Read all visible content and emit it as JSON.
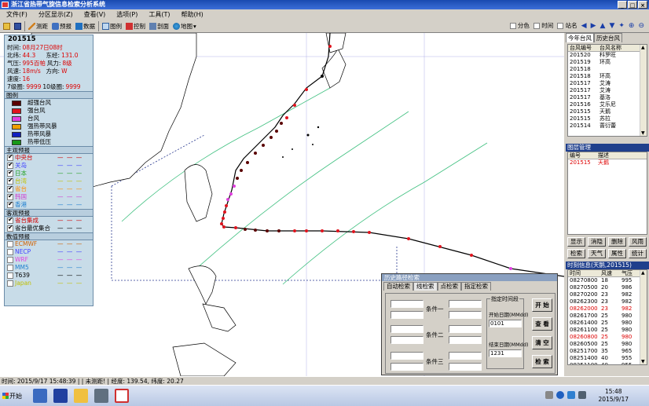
{
  "window": {
    "title": "浙江省热带气旋信息检索分析系统",
    "buttons": [
      "_",
      "□",
      "×"
    ]
  },
  "menu": [
    "文件(F)",
    "分区显示(Z)",
    "查看(V)",
    "选项(P)",
    "工具(T)",
    "帮助(H)"
  ],
  "toolbar": {
    "items": [
      {
        "icon": "folder-open-icon",
        "label": ""
      },
      {
        "icon": "save-icon",
        "label": ""
      },
      {
        "icon": "pencil-icon",
        "label": "测距"
      },
      {
        "icon": "forecast-icon",
        "label": "预报"
      },
      {
        "icon": "data-icon",
        "label": "数据"
      },
      {
        "icon": "layer-icon",
        "label": "图例"
      },
      {
        "icon": "control-icon",
        "label": "控制"
      },
      {
        "icon": "profile-icon",
        "label": "剖面"
      },
      {
        "icon": "globe-icon",
        "label": "地图"
      }
    ],
    "checks": [
      {
        "label": "分色",
        "checked": false
      },
      {
        "label": "时间",
        "checked": false
      },
      {
        "label": "站名",
        "checked": false
      }
    ],
    "nav_arrows": [
      "◀",
      "▶",
      "▲",
      "▼",
      "✦",
      "⊕",
      "⊖"
    ]
  },
  "info": {
    "storm_id": "201515",
    "fields": [
      {
        "label": "时间:",
        "value": "08月27日08时"
      },
      {
        "label": "北纬:",
        "value": "44.3",
        "label2": "东经:",
        "value2": "131.0"
      },
      {
        "label": "气压:",
        "value": "995百帕",
        "label2": "风力:",
        "value2": "8级"
      },
      {
        "label": "风速:",
        "value": "18m/s",
        "label2": "方向:",
        "value2": "W"
      },
      {
        "label": "速度:",
        "value": "16"
      },
      {
        "label": "7级圈:",
        "value": "9999",
        "label2": "10级圈:",
        "value2": "9999"
      }
    ],
    "legend_title": "图例",
    "legend": [
      {
        "label": "超强台风",
        "color": "#5a0000"
      },
      {
        "label": "强台风",
        "color": "#e0141e"
      },
      {
        "label": "台风",
        "color": "#e040e0"
      },
      {
        "label": "强热带风暴",
        "color": "#f0a000"
      },
      {
        "label": "热带风暴",
        "color": "#1020c0"
      },
      {
        "label": "热带低压",
        "color": "#189818"
      }
    ],
    "subjective_title": "主观预报",
    "subjective": [
      {
        "label": "中央台",
        "color": "#d00000",
        "checked": true
      },
      {
        "label": "关岛",
        "color": "#4040ff",
        "checked": true
      },
      {
        "label": "日本",
        "color": "#20a020",
        "checked": true
      },
      {
        "label": "台湾",
        "color": "#c0c000",
        "checked": true
      },
      {
        "label": "省台",
        "color": "#ff8c00",
        "checked": true
      },
      {
        "label": "韩国",
        "color": "#d040d0",
        "checked": true
      },
      {
        "label": "香港",
        "color": "#2080d0",
        "checked": true
      }
    ],
    "objective_title": "客观预报",
    "objective": [
      {
        "label": "省台集成",
        "color": "#d00000",
        "checked": true
      },
      {
        "label": "省台最优集合",
        "color": "#000000",
        "checked": true
      }
    ],
    "nwp_title": "数值预报",
    "nwp": [
      {
        "label": "ECMWF",
        "color": "#d06000",
        "checked": false
      },
      {
        "label": "NECP",
        "color": "#4040ff",
        "checked": false
      },
      {
        "label": "WRF",
        "color": "#e040e0",
        "checked": false
      },
      {
        "label": "MM5",
        "color": "#2080d0",
        "checked": false
      },
      {
        "label": "T639",
        "color": "#000000",
        "checked": false
      },
      {
        "label": "Japan",
        "color": "#c0c000",
        "checked": false
      }
    ]
  },
  "right": {
    "tabs": [
      "今年台风",
      "历史台风"
    ],
    "typhoon_cols": [
      "台风编号",
      "台风名称"
    ],
    "typhoons": [
      [
        "201520",
        "科罗旺"
      ],
      [
        "201519",
        "环高"
      ],
      [
        "201518",
        ""
      ],
      [
        "201518",
        "环高"
      ],
      [
        "201517",
        "艾涛"
      ],
      [
        "201517",
        "艾涛"
      ],
      [
        "201517",
        "基洛"
      ],
      [
        "201516",
        "艾乐尼"
      ],
      [
        "201515",
        "天鹅"
      ],
      [
        "201515",
        "苏拉"
      ],
      [
        "201514",
        "蔷衍蕾"
      ]
    ],
    "mgmt_title": "图层管理",
    "mgmt_cols": [
      "编号",
      "描述"
    ],
    "mgmt_rows": [
      [
        "201515",
        "天鹅"
      ]
    ],
    "buttons_row1": [
      "显示",
      "消隐",
      "删除",
      "风雨"
    ],
    "buttons_row2": [
      "检索",
      "天气",
      "属性",
      "统计"
    ],
    "timeinfo_title": "时刻信息(天鹅,201515)",
    "time_cols": [
      "时间",
      "风速",
      "气压"
    ],
    "time_rows": [
      [
        "08270800",
        "18",
        "995",
        false
      ],
      [
        "08270500",
        "20",
        "986",
        false
      ],
      [
        "08270200",
        "23",
        "982",
        false
      ],
      [
        "08262300",
        "23",
        "982",
        false
      ],
      [
        "08262000",
        "23",
        "982",
        true
      ],
      [
        "08261700",
        "25",
        "980",
        false
      ],
      [
        "08261400",
        "25",
        "980",
        false
      ],
      [
        "08261100",
        "25",
        "980",
        false
      ],
      [
        "08260800",
        "25",
        "980",
        true
      ],
      [
        "08260500",
        "25",
        "980",
        false
      ],
      [
        "08251700",
        "35",
        "965",
        false
      ],
      [
        "08251400",
        "40",
        "955",
        false
      ],
      [
        "08251100",
        "40",
        "955",
        false
      ]
    ]
  },
  "dialog": {
    "title": "历史路径检索",
    "tabs": [
      "自动检索",
      "线检索",
      "点检索",
      "指定检索"
    ],
    "cond_labels": [
      "条件一",
      "条件二",
      "条件三"
    ],
    "time_group": "指定时间段",
    "start_label": "开始日期(MMdd)",
    "start_value": "0101",
    "end_label": "结束日期(MMdd)",
    "end_value": "1231",
    "buttons": [
      "开 始",
      "查 看",
      "清 空",
      "检 索"
    ]
  },
  "status": "时间: 2015/9/17 15:48:39 | | 未测距! | 经度: 139.54, 纬度: 20.27",
  "taskbar": {
    "start": "开始",
    "time": "15:48",
    "date": "2015/9/17"
  }
}
